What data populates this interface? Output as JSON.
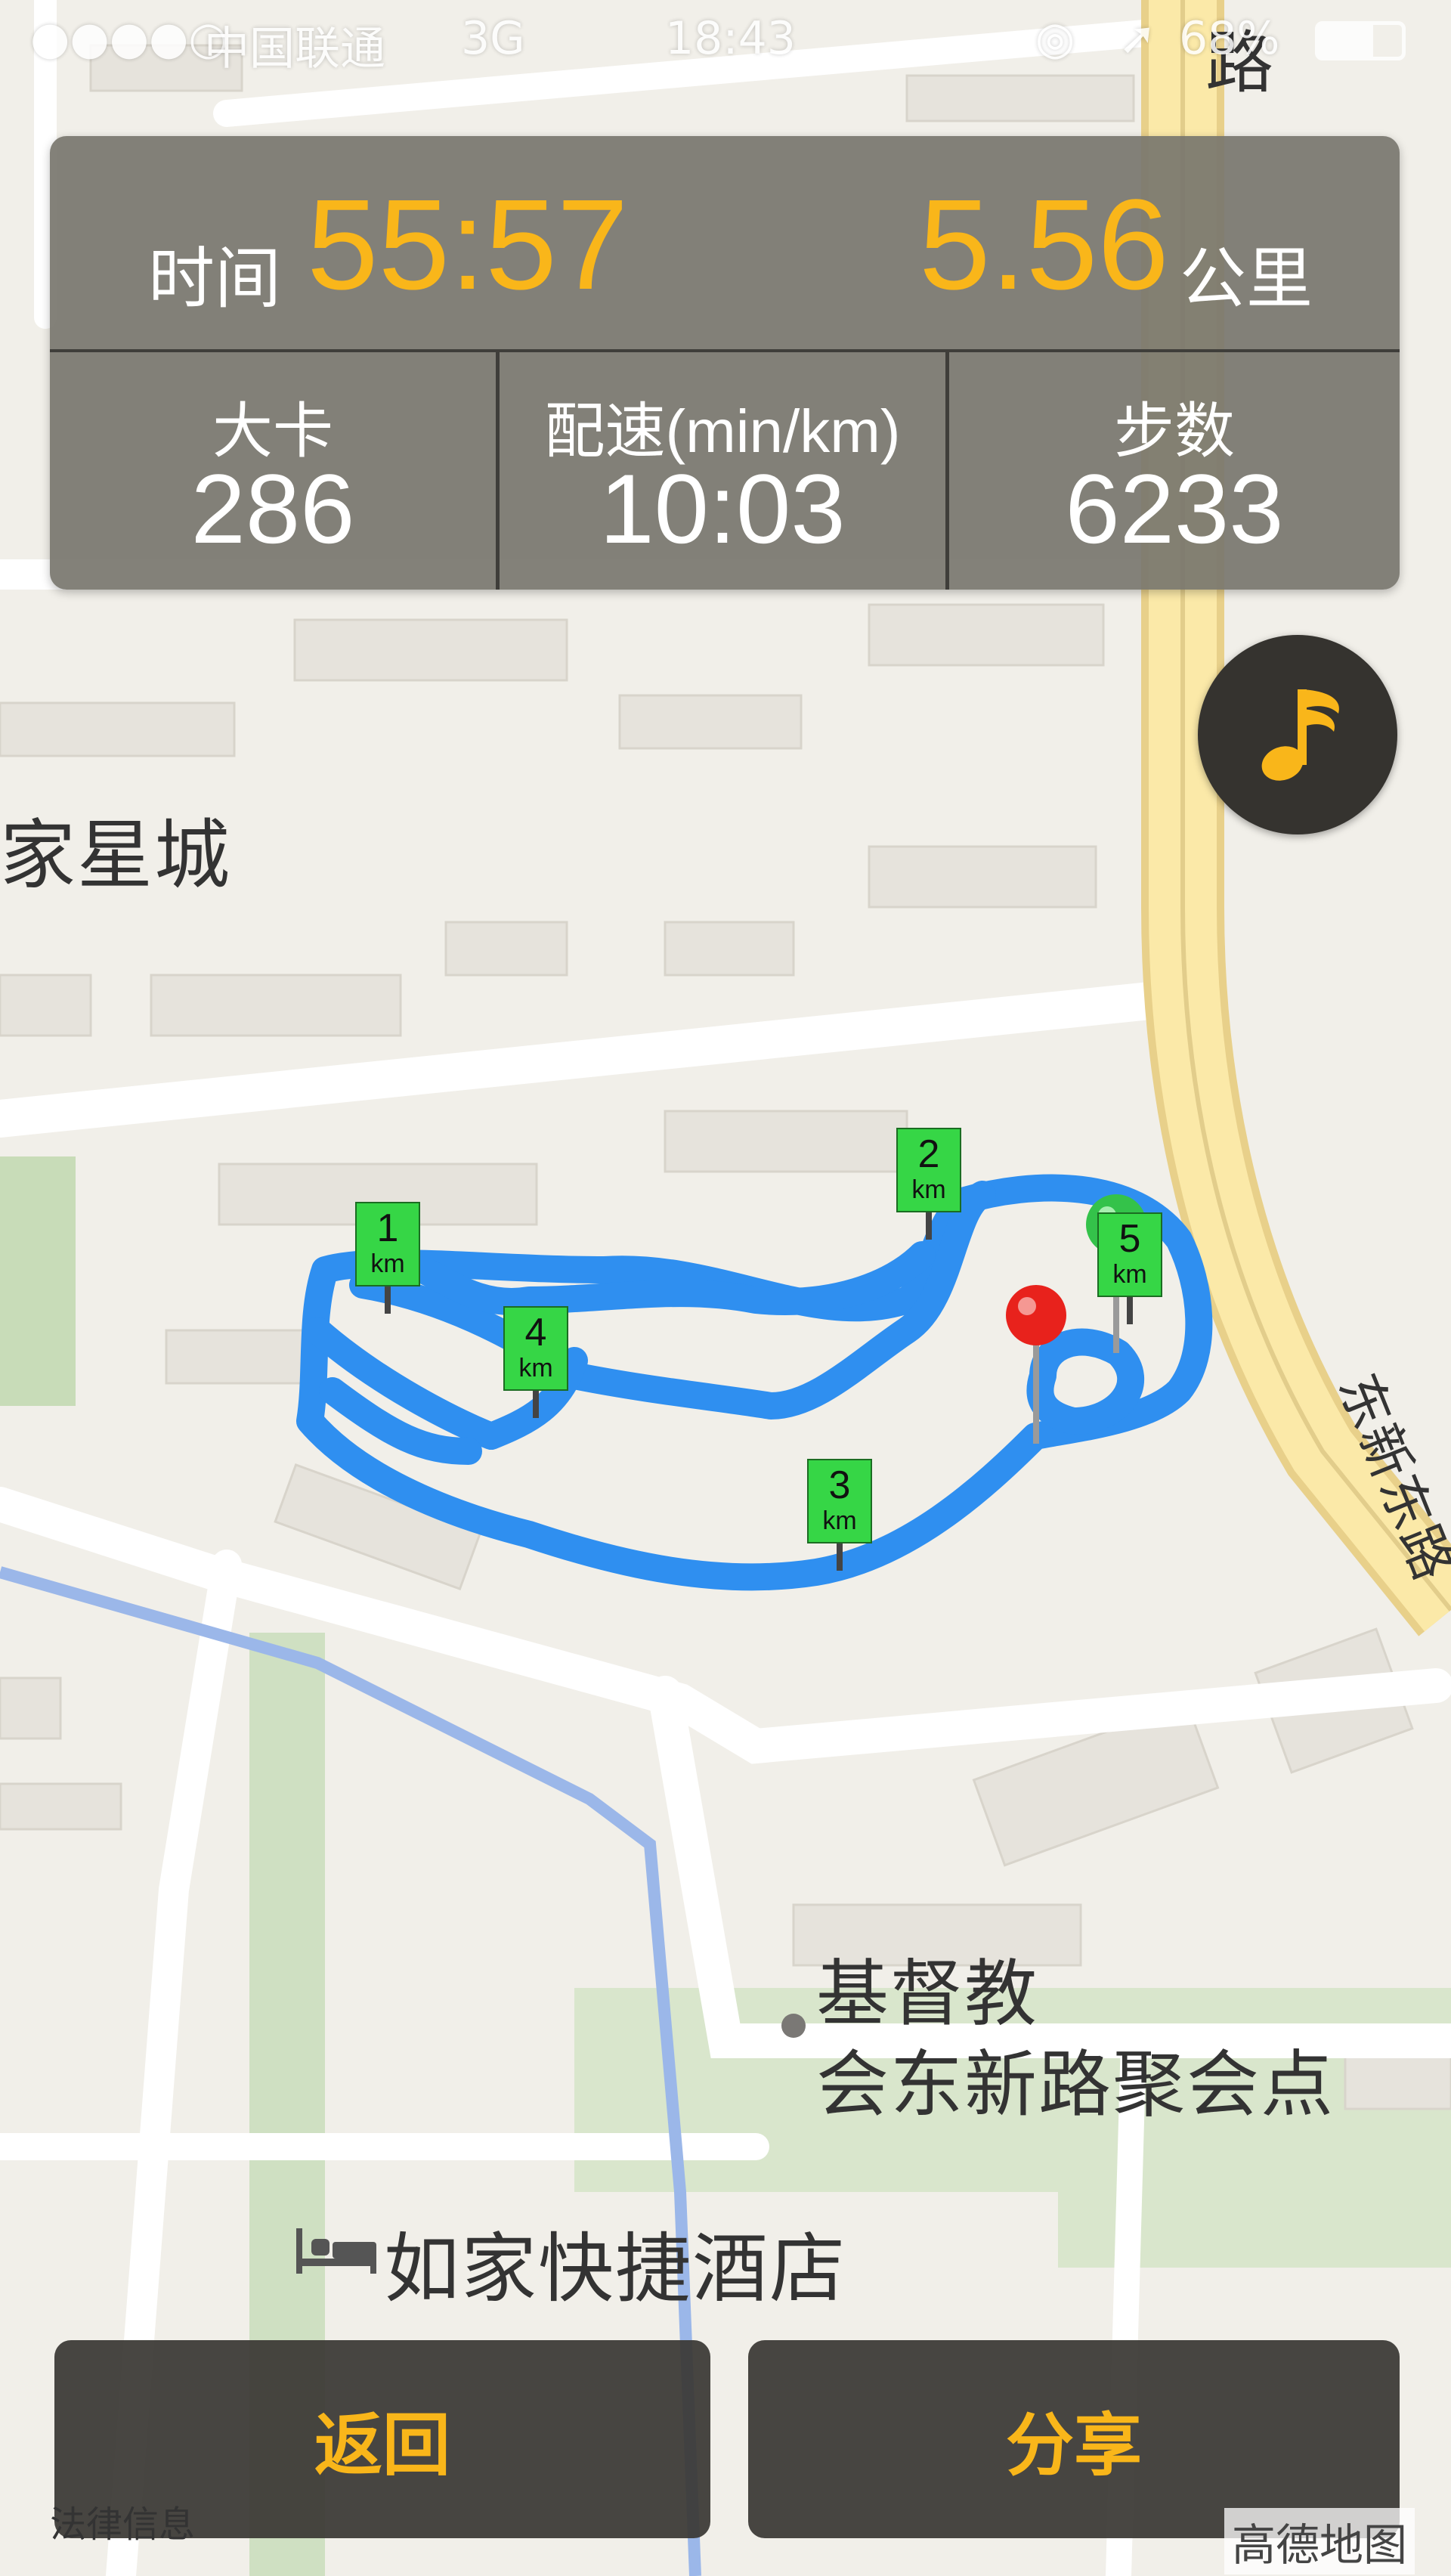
{
  "status_bar": {
    "carrier": "中国联通",
    "network": "3G",
    "time": "18:43",
    "battery": "68%"
  },
  "stats": {
    "time_label": "时间",
    "time_value": "55:57",
    "distance_value": "5.56",
    "distance_unit": "公里",
    "calories_label": "大卡",
    "calories_value": "286",
    "pace_label": "配速(min/km)",
    "pace_value": "10:03",
    "steps_label": "步数",
    "steps_value": "6233"
  },
  "map": {
    "labels": {
      "area": "家星城",
      "road_top": "路",
      "road_side": "东新东路",
      "poi_church_line1": "基督教",
      "poi_church_line2": "会东新路聚会点",
      "poi_hotel": "如家快捷酒店"
    },
    "km_markers": [
      {
        "number": "1",
        "unit": "km"
      },
      {
        "number": "2",
        "unit": "km"
      },
      {
        "number": "3",
        "unit": "km"
      },
      {
        "number": "4",
        "unit": "km"
      },
      {
        "number": "5",
        "unit": "km"
      }
    ],
    "route_color": "#2f8ff0",
    "start_pin_color": "#34c24a",
    "end_pin_color": "#e8221c"
  },
  "buttons": {
    "back_label": "返回",
    "share_label": "分享"
  },
  "footer": {
    "legal_label": "法律信息",
    "map_provider": "高德地图"
  },
  "colors": {
    "accent": "#f9b61a",
    "panel": "#78766e",
    "button_bg": "#3a3834"
  }
}
